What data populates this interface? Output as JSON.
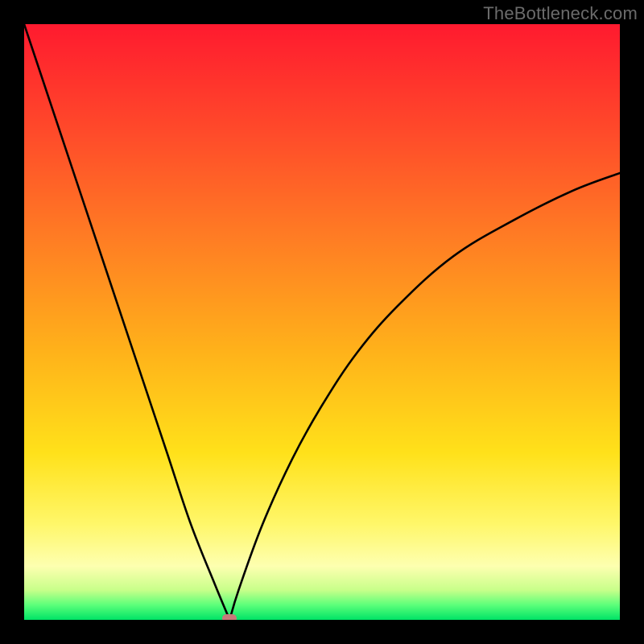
{
  "watermark": "TheBottleneck.com",
  "chart_data": {
    "type": "line",
    "title": "",
    "xlabel": "",
    "ylabel": "",
    "xlim": [
      0,
      100
    ],
    "ylim": [
      0,
      100
    ],
    "grid": false,
    "legend": false,
    "background_zones": [
      {
        "name": "red",
        "y_from": 100,
        "y_to": 65
      },
      {
        "name": "orange",
        "y_from": 65,
        "y_to": 35
      },
      {
        "name": "yellow",
        "y_from": 35,
        "y_to": 12
      },
      {
        "name": "pale",
        "y_from": 12,
        "y_to": 4
      },
      {
        "name": "green",
        "y_from": 4,
        "y_to": 0
      }
    ],
    "series": [
      {
        "name": "bottleneck-curve",
        "color": "#000000",
        "x": [
          0,
          4,
          8,
          12,
          16,
          20,
          24,
          28,
          32,
          34.5,
          36,
          40,
          45,
          50,
          56,
          63,
          72,
          82,
          92,
          100
        ],
        "values": [
          100,
          88,
          76,
          64,
          52,
          40,
          28,
          16,
          6,
          0,
          5,
          16,
          27,
          36,
          45,
          53,
          61,
          67,
          72,
          75
        ]
      }
    ],
    "marker": {
      "x": 34.5,
      "y": 0,
      "shape": "pill",
      "color": "#c77a7a"
    }
  }
}
